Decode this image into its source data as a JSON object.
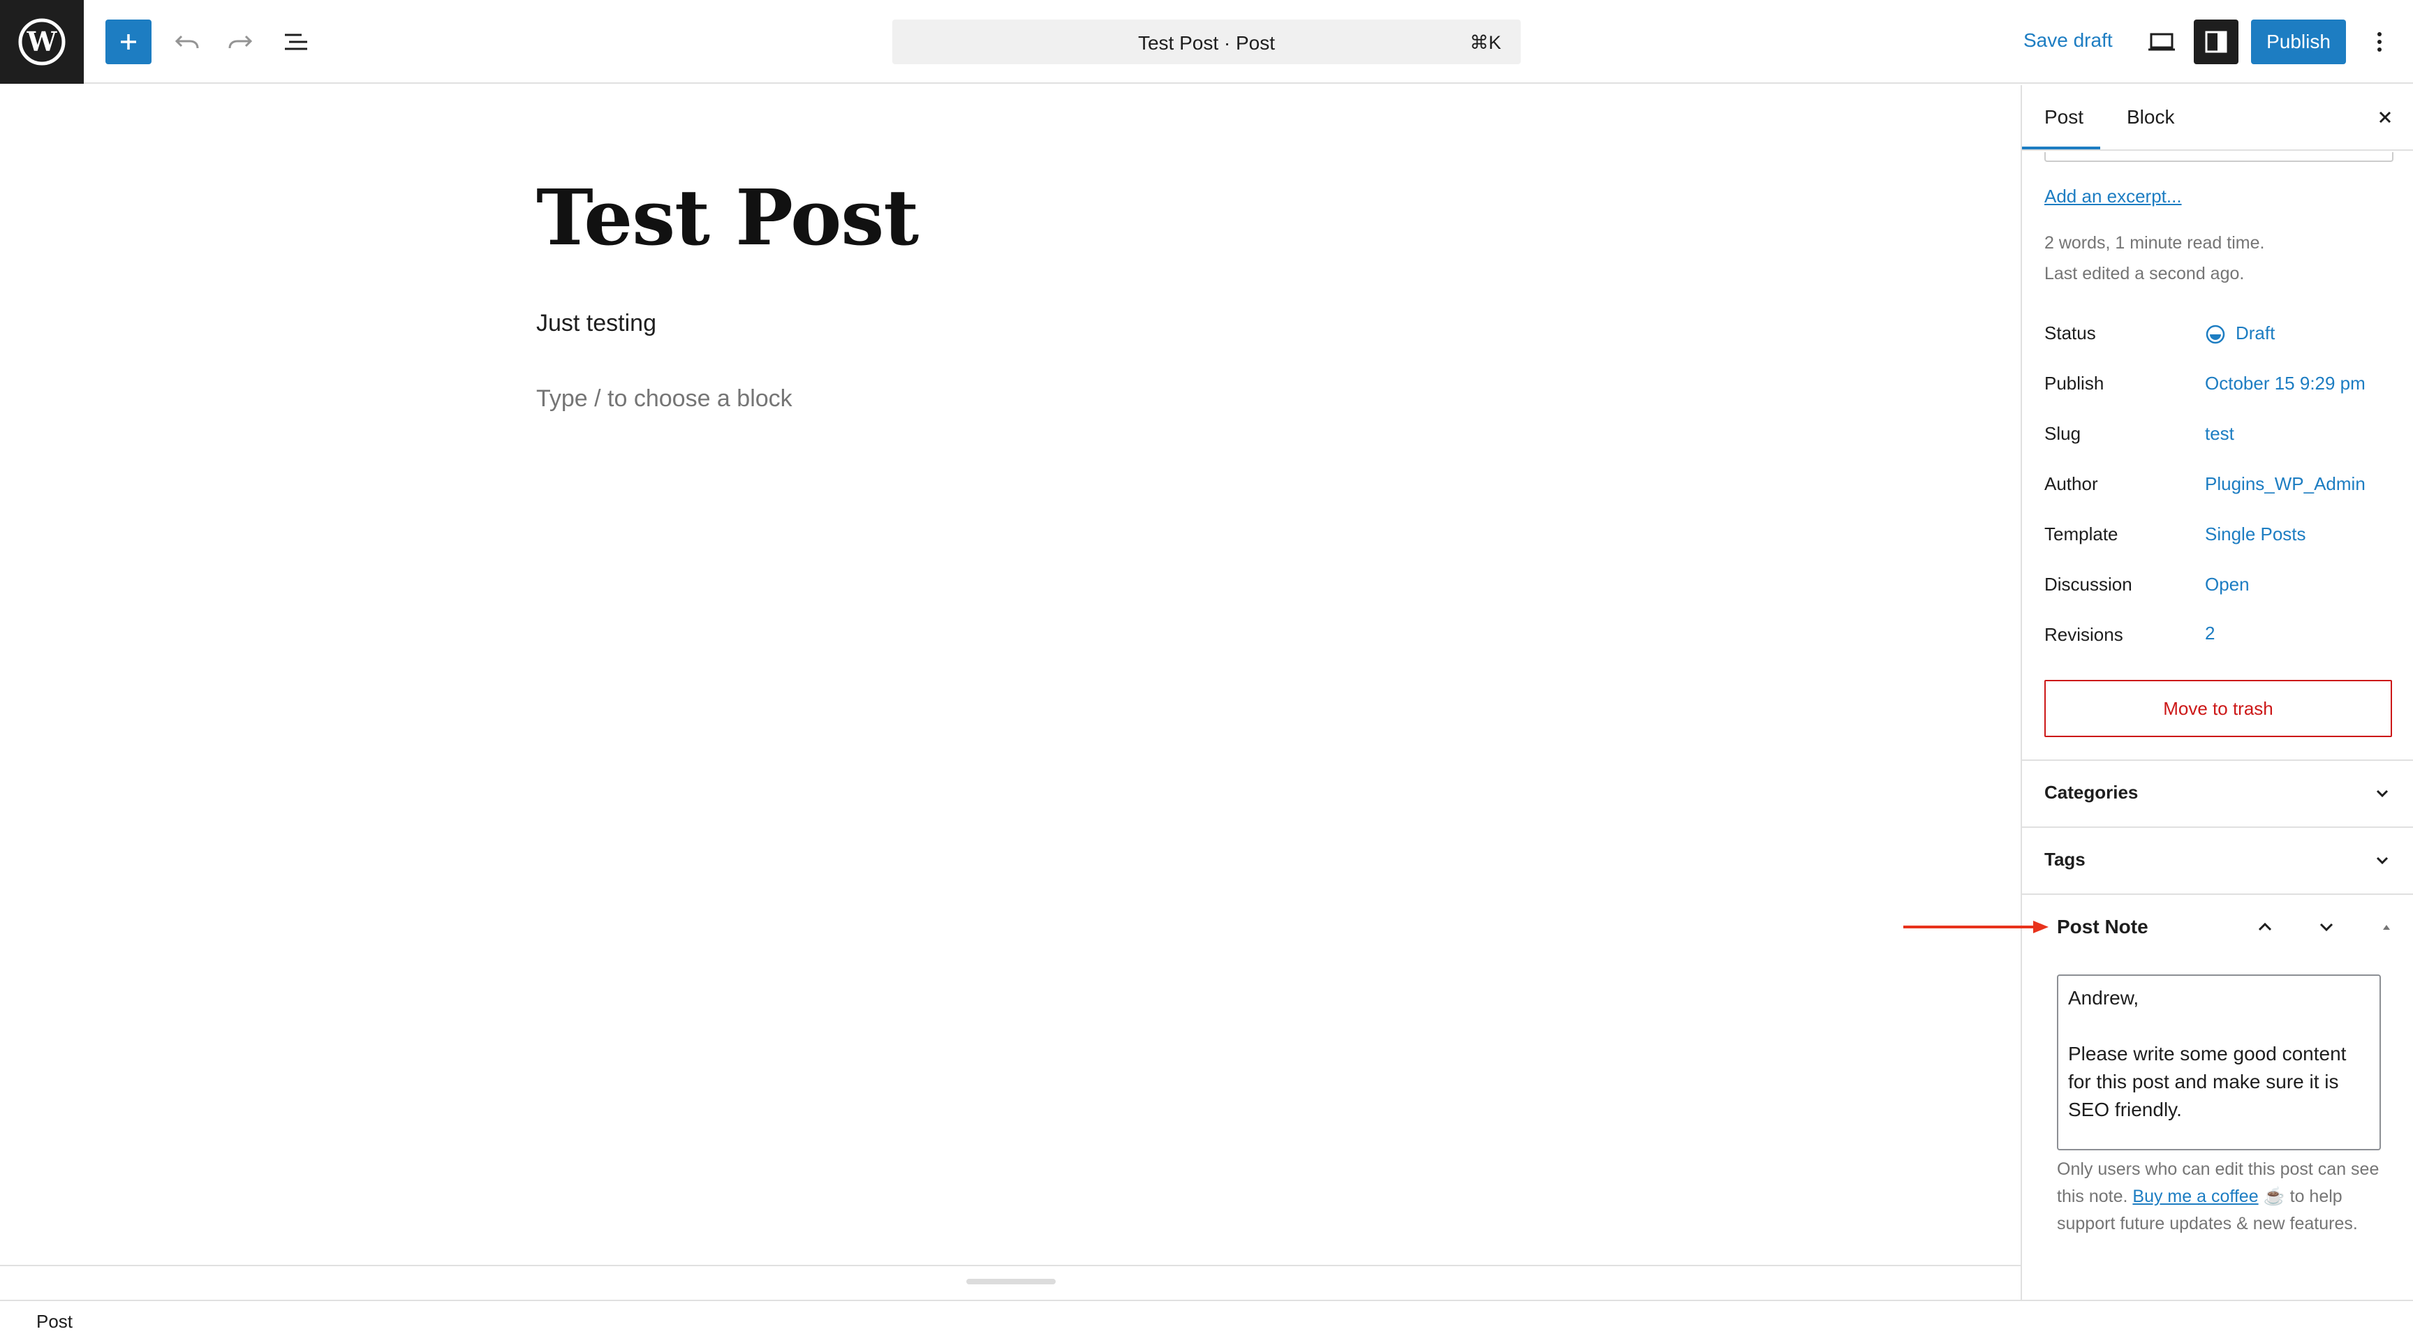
{
  "header": {
    "add_block_label": "+",
    "command_title": "Test Post · Post",
    "command_shortcut": "⌘K",
    "save_draft_label": "Save draft",
    "publish_label": "Publish",
    "icons": [
      "wordpress-logo-icon",
      "plus-icon",
      "undo-icon",
      "redo-icon",
      "document-overview-icon",
      "view-desktop-icon",
      "sidebar-toggle-icon",
      "more-options-icon"
    ]
  },
  "editor": {
    "post_title": "Test Post",
    "paragraph": "Just testing",
    "block_placeholder": "Type / to choose a block"
  },
  "sidebar": {
    "tabs": [
      {
        "label": "Post",
        "active": true
      },
      {
        "label": "Block",
        "active": false
      }
    ],
    "add_excerpt": "Add an excerpt...",
    "word_count": "2 words, 1 minute read time.",
    "last_edited": "Last edited a second ago.",
    "rows": [
      {
        "label": "Status",
        "value": "Draft"
      },
      {
        "label": "Publish",
        "value": "October 15 9:29 pm"
      },
      {
        "label": "Slug",
        "value": "test"
      },
      {
        "label": "Author",
        "value": "Plugins_WP_Admin"
      },
      {
        "label": "Template",
        "value": "Single Posts"
      },
      {
        "label": "Discussion",
        "value": "Open"
      },
      {
        "label": "Revisions",
        "value": "2"
      }
    ],
    "trash_label": "Move to trash",
    "panels": [
      {
        "label": "Categories"
      },
      {
        "label": "Tags"
      }
    ],
    "post_note": {
      "title": "Post Note",
      "text": "Andrew,\n\nPlease write some good content for this post and make sure it is SEO friendly.",
      "help_before": "Only users who can edit this post can see this note. ",
      "help_link": "Buy me a coffee",
      "help_after": " ☕ to help support future updates & new features."
    }
  },
  "footer": {
    "breadcrumb": "Post"
  },
  "colors": {
    "accent": "#1d7dc2",
    "danger": "#cc1818",
    "annotation": "#e8331c",
    "logo_bg": "#1e1e1e"
  }
}
